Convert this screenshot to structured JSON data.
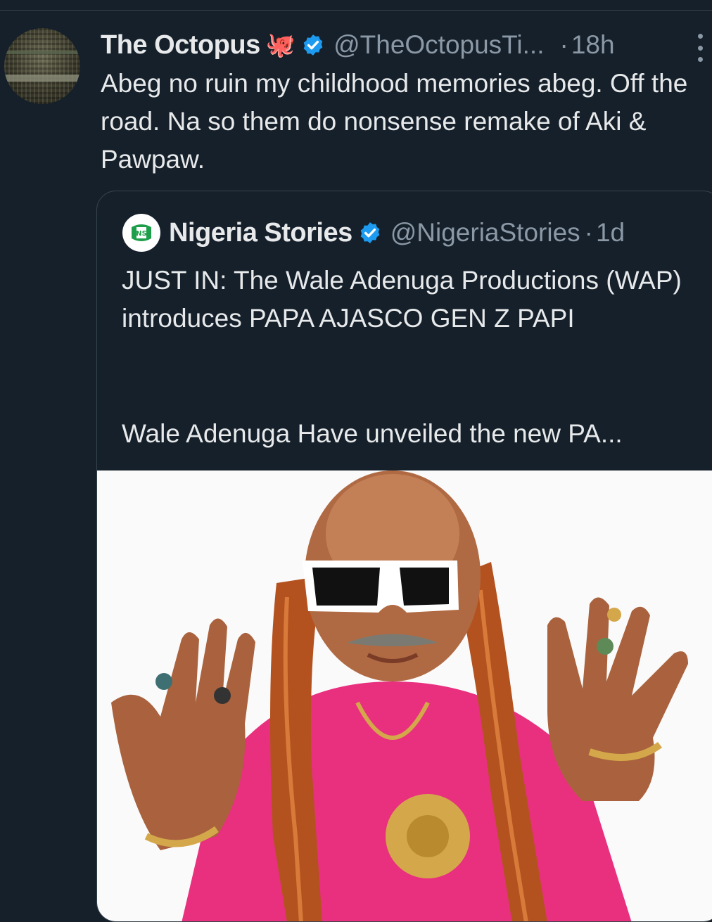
{
  "tweet": {
    "display_name": "The Octopus",
    "name_emoji": "🐙",
    "handle": "@TheOctopusTi...",
    "separator": "·",
    "time": "18h",
    "text": "Abeg no ruin my childhood memories abeg. Off the road. Na so them do nonsense remake of Aki & Pawpaw."
  },
  "quoted": {
    "display_name": "Nigeria Stories",
    "avatar_text": "NS",
    "handle": "@NigeriaStories",
    "separator": "·",
    "time": "1d",
    "text_main": "JUST IN: The Wale Adenuga Productions (WAP) introduces PAPA AJASCO GEN Z PAPI",
    "text_more": "Wale Adenuga  Have unveiled the new PA..."
  },
  "colors": {
    "background": "#15202b",
    "text": "#e7e9ea",
    "secondary": "#8b98a5",
    "verified": "#1d9bf0",
    "border": "#38444d"
  },
  "icons": {
    "verified": "verified-badge-icon",
    "more": "more-options-icon"
  }
}
